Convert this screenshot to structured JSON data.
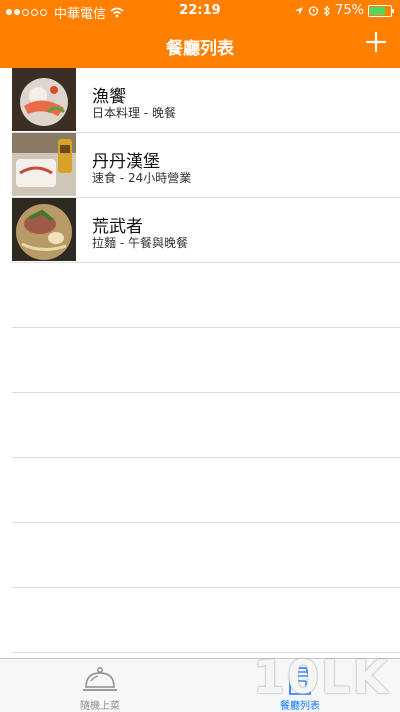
{
  "status_bar": {
    "carrier": "中華電信",
    "time": "22:19",
    "battery": "75%",
    "battery_level": 0.75
  },
  "nav": {
    "title": "餐廳列表",
    "add_icon": "plus-icon"
  },
  "restaurants": [
    {
      "name": "漁饗",
      "subtitle": "日本料理 - 晚餐"
    },
    {
      "name": "丹丹漢堡",
      "subtitle": "速食 - 24小時營業"
    },
    {
      "name": "荒武者",
      "subtitle": "拉麵 - 午餐與晚餐"
    }
  ],
  "tabs": [
    {
      "label": "隨機上菜",
      "icon": "cloche-icon",
      "active": false
    },
    {
      "label": "餐廳列表",
      "icon": "milk-carton-icon",
      "active": true
    }
  ],
  "watermark": "10LK",
  "colors": {
    "nav_bg": "#ff7f00",
    "tab_active": "#0a7aff",
    "tab_inactive": "#8e8e93",
    "battery_fill": "#4cd964"
  }
}
